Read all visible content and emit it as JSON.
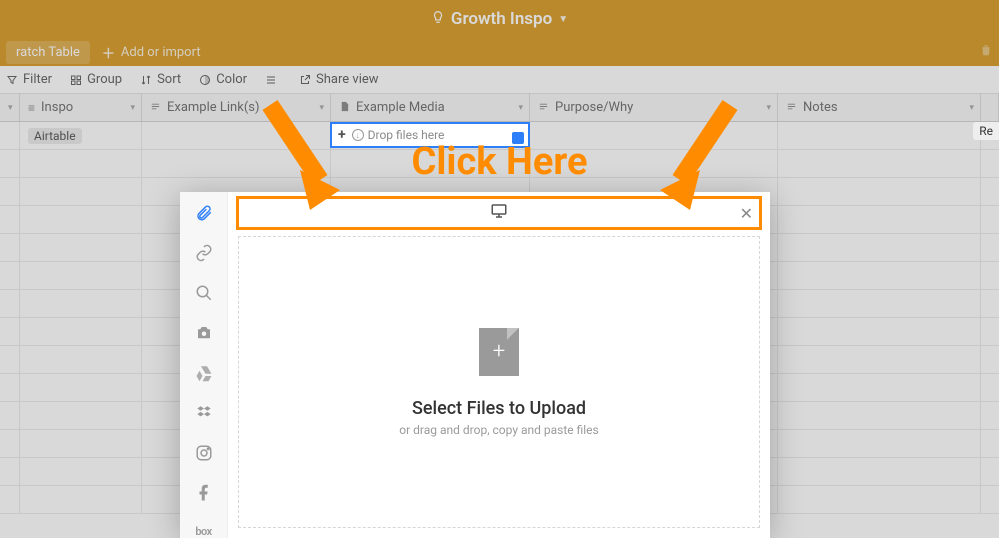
{
  "header": {
    "title": "Growth Inspo"
  },
  "tabs": {
    "active": "ratch Table",
    "add_label": "Add or import"
  },
  "toolbar": {
    "filter": "Filter",
    "group": "Group",
    "sort": "Sort",
    "color": "Color",
    "share": "Share view"
  },
  "columns": {
    "c1": "Inspo",
    "c2": "Example Link(s)",
    "c3": "Example Media",
    "c4": "Purpose/Why",
    "c5": "Notes"
  },
  "row1": {
    "tag": "Airtable",
    "re": "Re"
  },
  "active_cell": {
    "placeholder": "Drop files here"
  },
  "annotation": {
    "text": "Click Here"
  },
  "upload_modal": {
    "title": "Select Files to Upload",
    "sub": "or drag and drop, copy and paste files"
  }
}
